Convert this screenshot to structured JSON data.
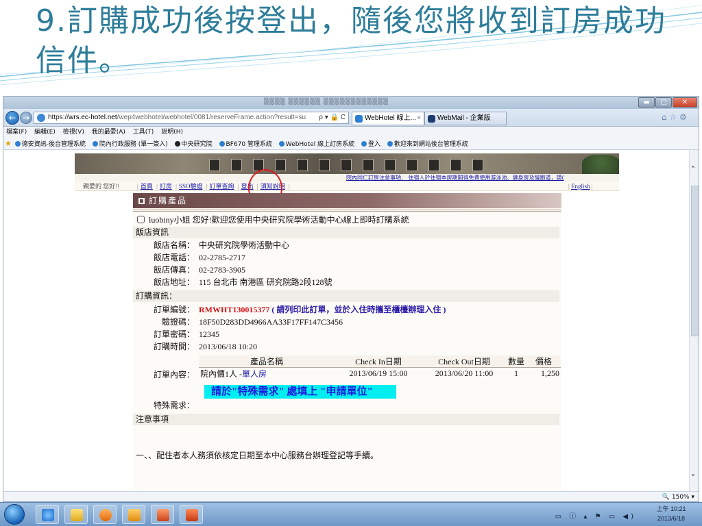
{
  "slide": {
    "title": "9.訂購成功後按登出，隨後您將收到訂房成功信件。"
  },
  "browser": {
    "address": {
      "scheme": "https://",
      "host": "wrs.ec-hotel.net",
      "path": "/wep4webhotel/webhotel/0081/reserveFrame.action?result=su",
      "tools": "ρ ▾ 🔒 C"
    },
    "tabs": [
      {
        "label": "WebHotel 線上...",
        "close": "×"
      },
      {
        "label": "WebMail - 企業版"
      }
    ],
    "nav_right": "⌂ ☆ ⚙",
    "menu": [
      "檔案(F)",
      "編輯(E)",
      "檢視(V)",
      "我的最愛(A)",
      "工具(T)",
      "說明(H)"
    ],
    "favorites": [
      "德安資訊-後台管理系統",
      "院內行政服務 (單一簽入)",
      "中央研究院",
      "BF670 管理系統",
      "WebHotel 線上訂房系統",
      "登入",
      "歡迎來到網站後台管理系統"
    ],
    "zoom": "150%",
    "window": {
      "min": "▬",
      "max": "▢",
      "close": "✕"
    }
  },
  "page": {
    "notice": "院內同仁訂房注意事項．  住宿人於住宿本房期間得免費使用游泳池、健身房及慢跑道，請(",
    "greeting": "親愛的 您好!!",
    "nav_links": [
      "首頁",
      "訂房",
      "SSO驗證",
      "訂單查詢",
      "登出",
      "須知說明"
    ],
    "nav_sep": "|",
    "english": "English",
    "panel_title": "訂購產品",
    "welcome": "luobiny小姐 您好!歡迎您使用中央研究院學術活動中心線上即時訂購系統",
    "hotel_section": "飯店資訊",
    "hotel": [
      {
        "label": "飯店名稱：",
        "value": "中央研究院學術活動中心"
      },
      {
        "label": "飯店電話：",
        "value": "02-2785-2717"
      },
      {
        "label": "飯店傳真：",
        "value": "02-2783-3905"
      },
      {
        "label": "飯店地址：",
        "value": "115 台北市 南港區 研究院路2段128號"
      }
    ],
    "order_section": "訂購資訊：",
    "order": {
      "number_label": "訂單編號：",
      "number": "RMWHT130015377",
      "number_note": "( 請列印此訂單，並於入住時攜至櫃檯辦理入住 )",
      "verify_label": "驗證碼：",
      "verify": "18F50D283DD4966AA33F17FF147C3456",
      "password_label": "訂單密碼：",
      "password": "12345",
      "time_label": "訂購時間：",
      "time": "2013/06/18 10:20",
      "content_label": "訂單內容：",
      "special_label": "特殊需求："
    },
    "items_table": {
      "headers": [
        "產品名稱",
        "Check In日期",
        "Check Out日期",
        "數量",
        "價格"
      ],
      "rows": [
        {
          "product_prefix": "院內價1人 -",
          "product_link": "單人房",
          "checkin": "2013/06/19 15:00",
          "checkout": "2013/06/20 11:00",
          "qty": "1",
          "price": "1,250"
        }
      ]
    },
    "hint": "請於\"特殊需求\" 處填上   \"申請單位\"",
    "notes_section": "注意事項",
    "note_1": "一、、配住者本人務須依核定日期至本中心服務台辦理登記等手續。"
  },
  "taskbar": {
    "tray": "▭ ⓘ ▴ ⚑ ▭ ◀)",
    "time": "上午 10:21",
    "date": "2013/6/18"
  },
  "colors": {
    "title": "#2e7d9a",
    "panel_head": "#6a4848",
    "hint_bg": "#00eef0",
    "order_number": "#d0141a",
    "highlight_circle": "#e01b1b"
  }
}
